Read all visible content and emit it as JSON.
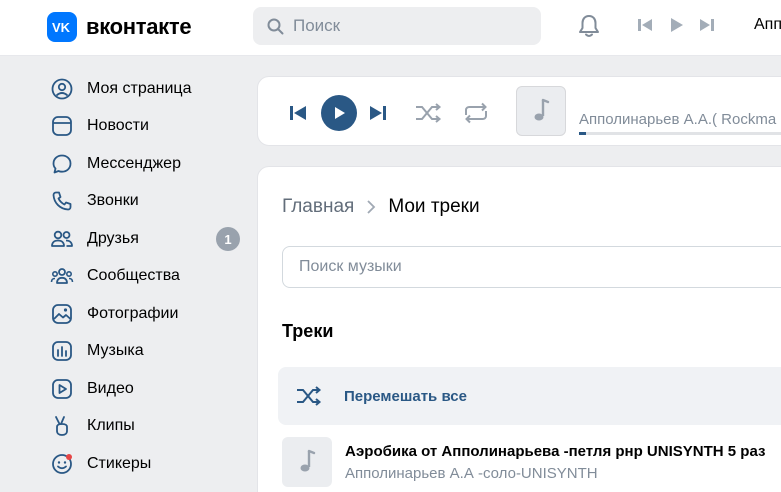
{
  "header": {
    "logo_text": "вконтакте",
    "search_placeholder": "Поиск",
    "now_playing_truncated": "Апп"
  },
  "sidebar": {
    "items": [
      {
        "label": "Моя страница",
        "icon": "user-circle-icon"
      },
      {
        "label": "Новости",
        "icon": "news-icon"
      },
      {
        "label": "Мессенджер",
        "icon": "message-icon"
      },
      {
        "label": "Звонки",
        "icon": "phone-icon"
      },
      {
        "label": "Друзья",
        "icon": "friends-icon",
        "badge": "1"
      },
      {
        "label": "Сообщества",
        "icon": "communities-icon"
      },
      {
        "label": "Фотографии",
        "icon": "photo-icon"
      },
      {
        "label": "Музыка",
        "icon": "music-icon"
      },
      {
        "label": "Видео",
        "icon": "video-icon"
      },
      {
        "label": "Клипы",
        "icon": "clips-icon"
      },
      {
        "label": "Стикеры",
        "icon": "sticker-icon"
      }
    ]
  },
  "player": {
    "artist": "Апполинарьев А.А.( Rockma",
    "progress": 0.01
  },
  "main": {
    "breadcrumb_home": "Главная",
    "breadcrumb_current": "Мои треки",
    "music_search_placeholder": "Поиск музыки",
    "tracks_heading": "Треки",
    "shuffle_label": "Перемешать все",
    "tracks": [
      {
        "title": "Аэробика от Апполинарьева -петля pнp UNISYNTH 5 раз",
        "artist": "Апполинарьев А.А -соло-UNISYNTH"
      }
    ]
  },
  "colors": {
    "accent": "#2a5885",
    "brand": "#0077ff",
    "background": "#edeef0",
    "secondary_text": "#818c99"
  }
}
